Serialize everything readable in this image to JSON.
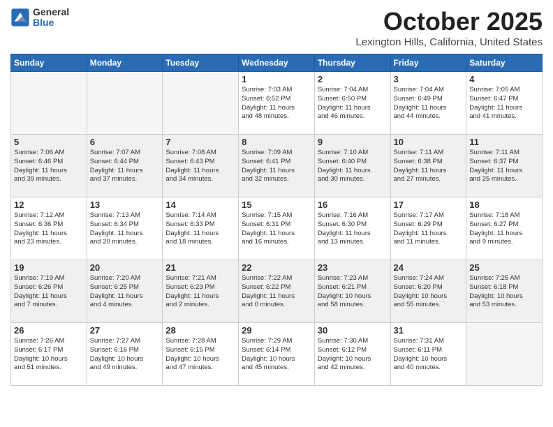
{
  "logo": {
    "general": "General",
    "blue": "Blue"
  },
  "title": "October 2025",
  "location": "Lexington Hills, California, United States",
  "days_of_week": [
    "Sunday",
    "Monday",
    "Tuesday",
    "Wednesday",
    "Thursday",
    "Friday",
    "Saturday"
  ],
  "weeks": [
    [
      {
        "day": "",
        "content": ""
      },
      {
        "day": "",
        "content": ""
      },
      {
        "day": "",
        "content": ""
      },
      {
        "day": "1",
        "content": "Sunrise: 7:03 AM\nSunset: 6:52 PM\nDaylight: 11 hours\nand 48 minutes."
      },
      {
        "day": "2",
        "content": "Sunrise: 7:04 AM\nSunset: 6:50 PM\nDaylight: 11 hours\nand 46 minutes."
      },
      {
        "day": "3",
        "content": "Sunrise: 7:04 AM\nSunset: 6:49 PM\nDaylight: 11 hours\nand 44 minutes."
      },
      {
        "day": "4",
        "content": "Sunrise: 7:05 AM\nSunset: 6:47 PM\nDaylight: 11 hours\nand 41 minutes."
      }
    ],
    [
      {
        "day": "5",
        "content": "Sunrise: 7:06 AM\nSunset: 6:46 PM\nDaylight: 11 hours\nand 39 minutes."
      },
      {
        "day": "6",
        "content": "Sunrise: 7:07 AM\nSunset: 6:44 PM\nDaylight: 11 hours\nand 37 minutes."
      },
      {
        "day": "7",
        "content": "Sunrise: 7:08 AM\nSunset: 6:43 PM\nDaylight: 11 hours\nand 34 minutes."
      },
      {
        "day": "8",
        "content": "Sunrise: 7:09 AM\nSunset: 6:41 PM\nDaylight: 11 hours\nand 32 minutes."
      },
      {
        "day": "9",
        "content": "Sunrise: 7:10 AM\nSunset: 6:40 PM\nDaylight: 11 hours\nand 30 minutes."
      },
      {
        "day": "10",
        "content": "Sunrise: 7:11 AM\nSunset: 6:38 PM\nDaylight: 11 hours\nand 27 minutes."
      },
      {
        "day": "11",
        "content": "Sunrise: 7:11 AM\nSunset: 6:37 PM\nDaylight: 11 hours\nand 25 minutes."
      }
    ],
    [
      {
        "day": "12",
        "content": "Sunrise: 7:12 AM\nSunset: 6:36 PM\nDaylight: 11 hours\nand 23 minutes."
      },
      {
        "day": "13",
        "content": "Sunrise: 7:13 AM\nSunset: 6:34 PM\nDaylight: 11 hours\nand 20 minutes."
      },
      {
        "day": "14",
        "content": "Sunrise: 7:14 AM\nSunset: 6:33 PM\nDaylight: 11 hours\nand 18 minutes."
      },
      {
        "day": "15",
        "content": "Sunrise: 7:15 AM\nSunset: 6:31 PM\nDaylight: 11 hours\nand 16 minutes."
      },
      {
        "day": "16",
        "content": "Sunrise: 7:16 AM\nSunset: 6:30 PM\nDaylight: 11 hours\nand 13 minutes."
      },
      {
        "day": "17",
        "content": "Sunrise: 7:17 AM\nSunset: 6:29 PM\nDaylight: 11 hours\nand 11 minutes."
      },
      {
        "day": "18",
        "content": "Sunrise: 7:18 AM\nSunset: 6:27 PM\nDaylight: 11 hours\nand 9 minutes."
      }
    ],
    [
      {
        "day": "19",
        "content": "Sunrise: 7:19 AM\nSunset: 6:26 PM\nDaylight: 11 hours\nand 7 minutes."
      },
      {
        "day": "20",
        "content": "Sunrise: 7:20 AM\nSunset: 6:25 PM\nDaylight: 11 hours\nand 4 minutes."
      },
      {
        "day": "21",
        "content": "Sunrise: 7:21 AM\nSunset: 6:23 PM\nDaylight: 11 hours\nand 2 minutes."
      },
      {
        "day": "22",
        "content": "Sunrise: 7:22 AM\nSunset: 6:22 PM\nDaylight: 11 hours\nand 0 minutes."
      },
      {
        "day": "23",
        "content": "Sunrise: 7:23 AM\nSunset: 6:21 PM\nDaylight: 10 hours\nand 58 minutes."
      },
      {
        "day": "24",
        "content": "Sunrise: 7:24 AM\nSunset: 6:20 PM\nDaylight: 10 hours\nand 55 minutes."
      },
      {
        "day": "25",
        "content": "Sunrise: 7:25 AM\nSunset: 6:18 PM\nDaylight: 10 hours\nand 53 minutes."
      }
    ],
    [
      {
        "day": "26",
        "content": "Sunrise: 7:26 AM\nSunset: 6:17 PM\nDaylight: 10 hours\nand 51 minutes."
      },
      {
        "day": "27",
        "content": "Sunrise: 7:27 AM\nSunset: 6:16 PM\nDaylight: 10 hours\nand 49 minutes."
      },
      {
        "day": "28",
        "content": "Sunrise: 7:28 AM\nSunset: 6:15 PM\nDaylight: 10 hours\nand 47 minutes."
      },
      {
        "day": "29",
        "content": "Sunrise: 7:29 AM\nSunset: 6:14 PM\nDaylight: 10 hours\nand 45 minutes."
      },
      {
        "day": "30",
        "content": "Sunrise: 7:30 AM\nSunset: 6:12 PM\nDaylight: 10 hours\nand 42 minutes."
      },
      {
        "day": "31",
        "content": "Sunrise: 7:31 AM\nSunset: 6:11 PM\nDaylight: 10 hours\nand 40 minutes."
      },
      {
        "day": "",
        "content": ""
      }
    ]
  ]
}
